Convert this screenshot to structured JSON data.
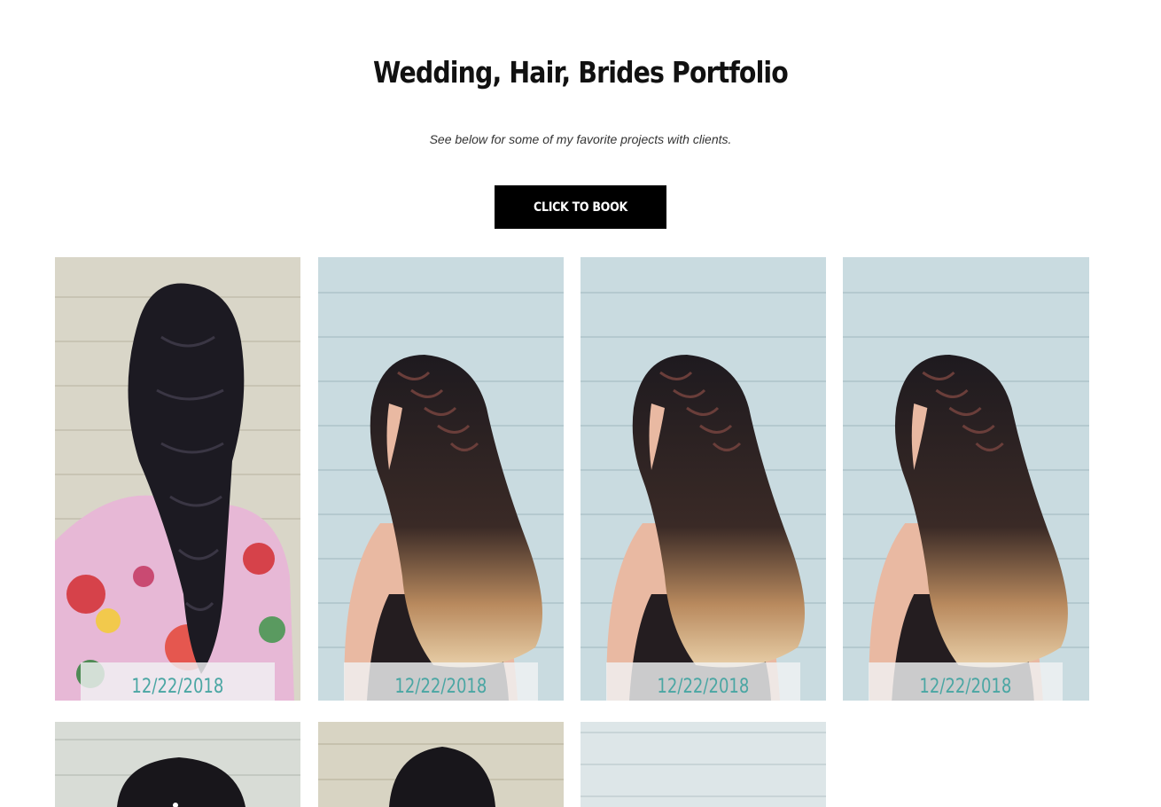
{
  "header": {
    "title": "Wedding, Hair, Brides Portfolio",
    "subtitle": "See below for some of my favorite projects with clients.",
    "cta_label": "CLICK TO BOOK"
  },
  "gallery": {
    "caption_color": "#4aa6a3",
    "row1": [
      {
        "date": "12/22/2018",
        "photo": "curly-braid-floral-robe"
      },
      {
        "date": "12/22/2018",
        "photo": "braided-ombre-waves"
      },
      {
        "date": "12/22/2018",
        "photo": "braided-ombre-waves"
      },
      {
        "date": "12/22/2018",
        "photo": "braided-ombre-waves"
      }
    ],
    "row2": [
      {
        "photo": "updo-wood-wall"
      },
      {
        "photo": "updo-beige-wall"
      },
      {
        "photo": "wood-wall"
      }
    ]
  }
}
